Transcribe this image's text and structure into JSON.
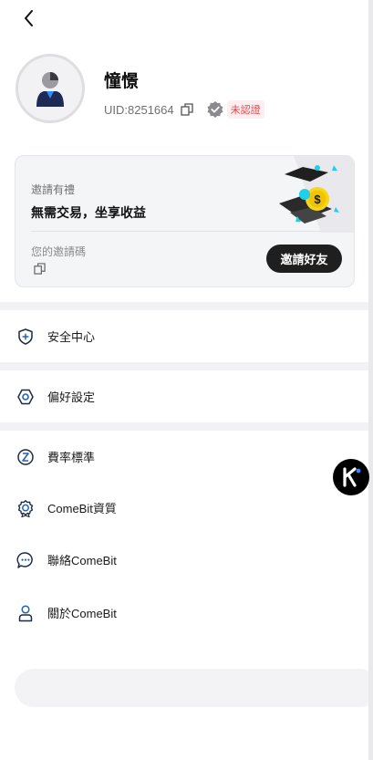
{
  "profile": {
    "name": "憧憬",
    "uid": "UID:8251664",
    "verification_status": "未認證"
  },
  "invite": {
    "title": "邀請有禮",
    "slogan": "無需交易，坐享收益",
    "code_label": "您的邀請碼",
    "button_label": "邀請好友"
  },
  "menu": {
    "items": [
      {
        "label": "安全中心",
        "icon": "shield-icon"
      },
      {
        "label": "偏好設定",
        "icon": "settings-hexagon-icon"
      },
      {
        "label": "費率標準",
        "icon": "percent-icon"
      },
      {
        "label": "ComeBit資質",
        "icon": "certificate-icon"
      },
      {
        "label": "聯絡ComeBit",
        "icon": "chat-icon"
      },
      {
        "label": "關於ComeBit",
        "icon": "person-icon"
      }
    ]
  },
  "colors": {
    "accent_blue": "#1e63b8",
    "unverified_red": "#e0454e",
    "dark_button": "#1f1f1f",
    "coin_yellow": "#f6d51b",
    "cyan": "#1fd0e8"
  }
}
